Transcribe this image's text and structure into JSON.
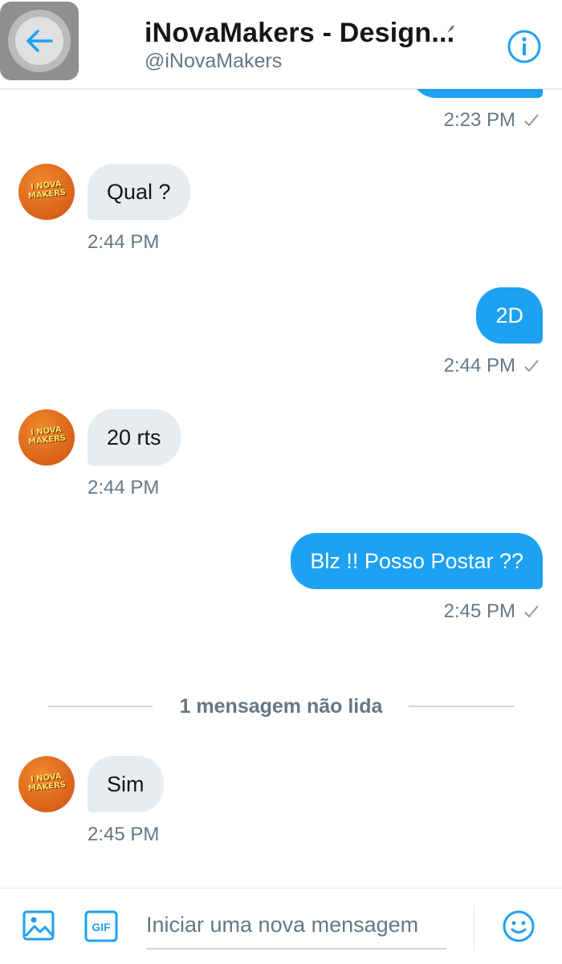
{
  "header": {
    "title": "iNovaMakers - Design...",
    "handle": "@iNovaMakers",
    "icons": [
      "back-arrow-icon",
      "pin-icon",
      "info-icon"
    ]
  },
  "colors": {
    "accent": "#1da1f2",
    "incoming_bubble": "#e6ecf0",
    "secondary_text": "#657786"
  },
  "messages": [
    {
      "direction": "out",
      "text": "",
      "time": "2:23 PM"
    },
    {
      "direction": "in",
      "text": "Qual ?",
      "time": "2:44 PM"
    },
    {
      "direction": "out",
      "text": "2D",
      "time": "2:44 PM"
    },
    {
      "direction": "in",
      "text": "20 rts",
      "time": "2:44 PM"
    },
    {
      "direction": "out",
      "text": "Blz !! Posso Postar ??",
      "time": "2:45 PM"
    },
    {
      "direction": "in",
      "text": "Sim",
      "time": "2:45 PM"
    }
  ],
  "avatar": {
    "text": "I NOVA MAKERS"
  },
  "unread_divider": "1 mensagem não lida",
  "composer": {
    "placeholder": "Iniciar uma nova mensagem",
    "gif_label": "GIF",
    "icons": [
      "image-icon",
      "gif-icon",
      "emoji-icon"
    ]
  }
}
